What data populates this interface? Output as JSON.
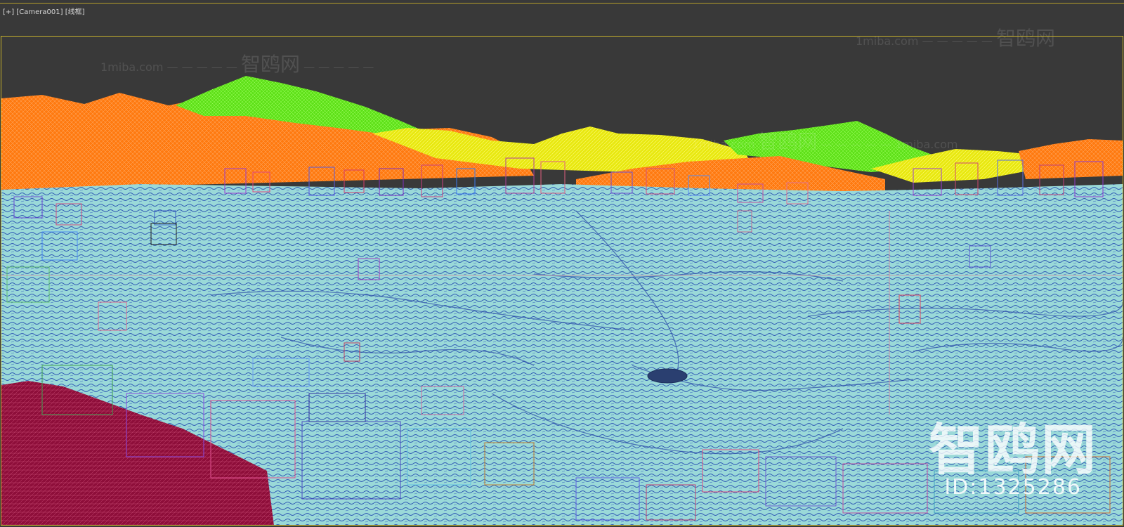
{
  "viewport": {
    "label_plus": "[+]",
    "label_camera": "[Camera001]",
    "label_mode": "[线框]"
  },
  "watermarks": {
    "site_small": "1miba.com",
    "dashes": "— — — — —",
    "site_cn": "智鸥网",
    "big_cn": "智鸥网",
    "id_text": "ID:1325286"
  },
  "colors": {
    "background": "#393939",
    "frame_border": "#c8b22c",
    "terrain_water": "#9ad9d8",
    "terrain_lines": "#2f58b4",
    "mountain_orange": "#ff7a10",
    "mountain_green": "#6ef21c",
    "mountain_yellow": "#f0f018",
    "foreground_crimson": "#8e0e3a"
  }
}
